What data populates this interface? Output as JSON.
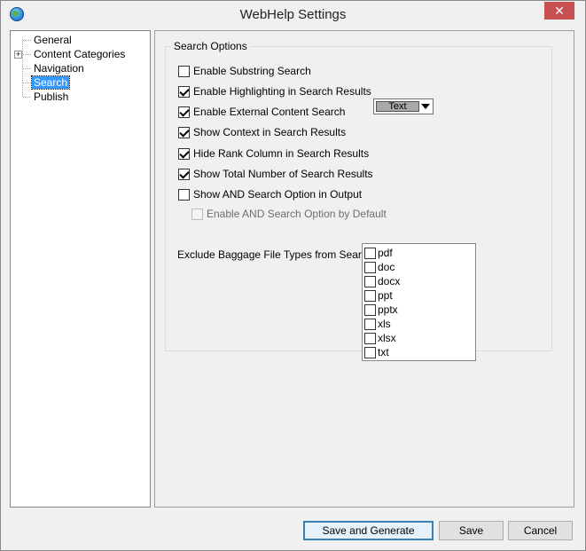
{
  "window": {
    "title": "WebHelp Settings",
    "close_label": "✕"
  },
  "tree": {
    "items": [
      {
        "label": "General",
        "expandable": false,
        "selected": false
      },
      {
        "label": "Content Categories",
        "expandable": true,
        "expander_symbol": "+",
        "selected": false
      },
      {
        "label": "Navigation",
        "expandable": false,
        "selected": false
      },
      {
        "label": "Search",
        "expandable": false,
        "selected": true
      },
      {
        "label": "Publish",
        "expandable": false,
        "selected": false
      }
    ]
  },
  "search_options": {
    "group_title": "Search Options",
    "options": [
      {
        "label": "Enable Substring Search",
        "checked": false,
        "enabled": true
      },
      {
        "label": "Enable Highlighting in Search Results",
        "checked": true,
        "enabled": true
      },
      {
        "label": "Enable External Content Search",
        "checked": true,
        "enabled": true
      },
      {
        "label": "Show Context in Search Results",
        "checked": true,
        "enabled": true
      },
      {
        "label": "Hide Rank Column in Search Results",
        "checked": true,
        "enabled": true
      },
      {
        "label": "Show Total Number of Search Results",
        "checked": true,
        "enabled": true
      },
      {
        "label": "Show AND Search Option in Output",
        "checked": false,
        "enabled": true
      },
      {
        "label": "Enable AND Search Option by Default",
        "checked": false,
        "enabled": false
      }
    ],
    "highlight_color": {
      "value": "Text",
      "swatch_color": "#a9a9ad"
    },
    "exclude_label": "Exclude Baggage File Types from Search :",
    "file_types": [
      {
        "label": "pdf",
        "checked": false
      },
      {
        "label": "doc",
        "checked": false
      },
      {
        "label": "docx",
        "checked": false
      },
      {
        "label": "ppt",
        "checked": false
      },
      {
        "label": "pptx",
        "checked": false
      },
      {
        "label": "xls",
        "checked": false
      },
      {
        "label": "xlsx",
        "checked": false
      },
      {
        "label": "txt",
        "checked": false
      }
    ]
  },
  "buttons": {
    "save_and_generate": "Save and Generate",
    "save": "Save",
    "cancel": "Cancel"
  },
  "colors": {
    "selection": "#3399ff",
    "close_button": "#c75050",
    "background": "#f0f0f0"
  }
}
